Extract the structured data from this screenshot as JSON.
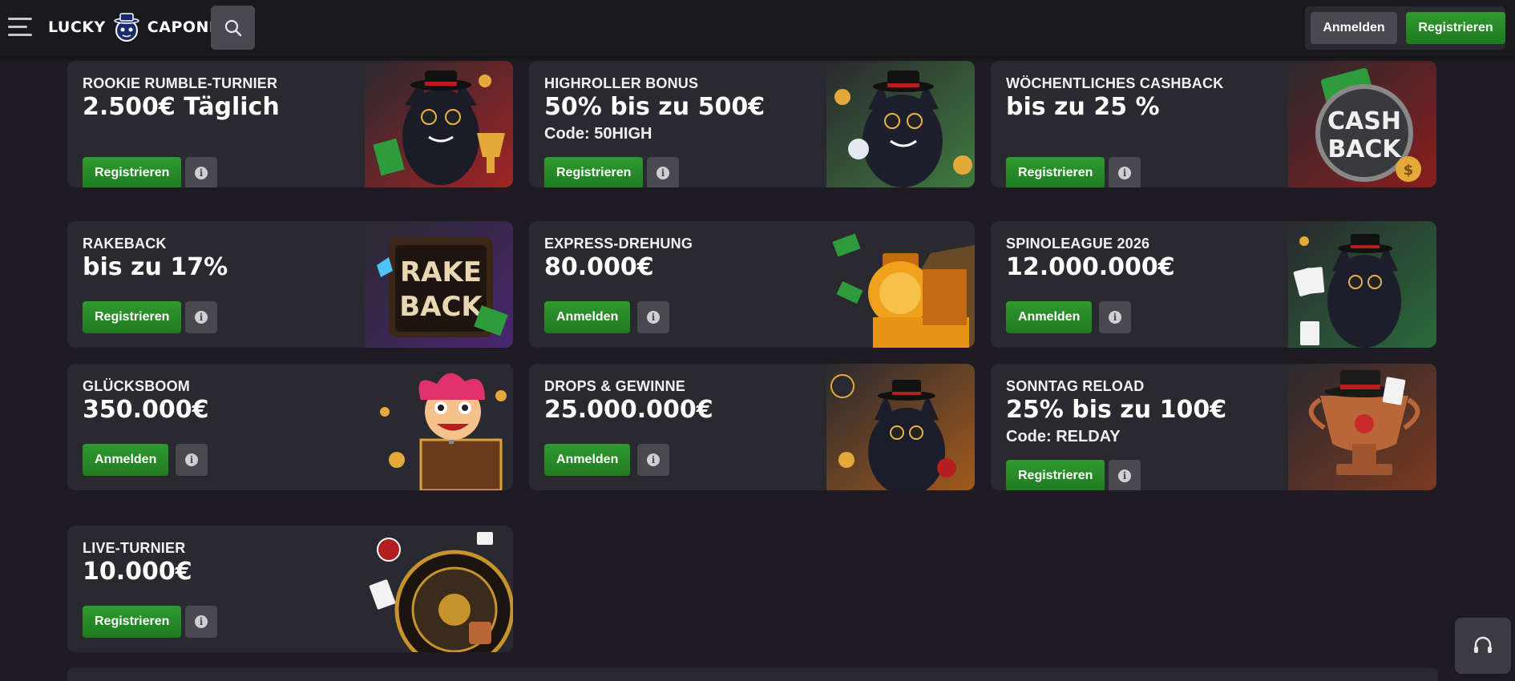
{
  "header": {
    "logo_left": "LUCKY",
    "logo_right": "CAPONE",
    "login_label": "Anmelden",
    "register_label": "Registrieren"
  },
  "promotions": [
    {
      "label": "ROOKIE RUMBLE-TURNIER",
      "value": "2.500€ Täglich",
      "code": "",
      "cta": "Registrieren",
      "art": "cat-trophy"
    },
    {
      "label": "HIGHROLLER BONUS",
      "value": "50% bis zu 500€",
      "code": "Code: 50HIGH",
      "cta": "Registrieren",
      "art": "cat-coins"
    },
    {
      "label": "WÖCHENTLICHES CASHBACK",
      "value": "bis zu 25 %",
      "code": "",
      "cta": "Registrieren",
      "art": "cashback"
    },
    {
      "label": "RAKEBACK",
      "value": "bis zu 17%",
      "code": "",
      "cta": "Registrieren",
      "art": "rakeback"
    },
    {
      "label": "EXPRESS-DREHUNG",
      "value": "80.000€",
      "code": "",
      "cta": "Anmelden",
      "art": "train"
    },
    {
      "label": "SPINOLEAGUE 2026",
      "value": "12.000.000€",
      "code": "",
      "cta": "Anmelden",
      "art": "cat-cards"
    },
    {
      "label": "GLÜCKSBOOM",
      "value": "350.000€",
      "code": "",
      "cta": "Anmelden",
      "art": "jester"
    },
    {
      "label": "DROPS & GEWINNE",
      "value": "25.000.000€",
      "code": "",
      "cta": "Anmelden",
      "art": "cat-drops"
    },
    {
      "label": "SONNTAG RELOAD",
      "value": "25% bis zu 100€",
      "code": "Code: RELDAY",
      "cta": "Registrieren",
      "art": "trophy"
    },
    {
      "label": "LIVE-TURNIER",
      "value": "10.000€",
      "code": "",
      "cta": "Registrieren",
      "art": "roulette"
    }
  ],
  "icons": {
    "menu": "hamburger-icon",
    "search": "search-icon",
    "info": "info-icon",
    "support": "headset-icon"
  },
  "colors": {
    "background": "#1e1c22",
    "card": "#2a292f",
    "header": "#1a191e",
    "primary_button": "#2a8a2a",
    "secondary_button": "#4a4950"
  }
}
